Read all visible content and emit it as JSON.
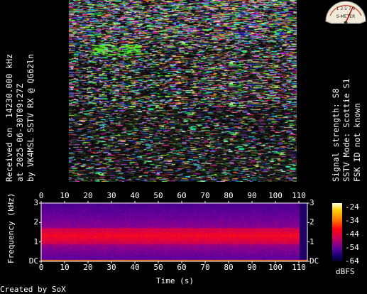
{
  "left_caption": {
    "line1": "Received on  14230.000 kHz",
    "line2": "at 2025-06-30T09:27Z",
    "line3": "by VK4MSL SSTV RX @ QG62ln"
  },
  "right_caption": {
    "line1": "Signal strength: S8",
    "line2": "SSTV Mode: Scottie S1",
    "line3": "FSK ID not known"
  },
  "meter": {
    "icon": "s-meter-icon",
    "scale_text": "1 3 5 7 9",
    "label": "S-METER"
  },
  "spectrogram": {
    "x_ticks": [
      "0",
      "10",
      "20",
      "30",
      "40",
      "50",
      "60",
      "70",
      "80",
      "90",
      "100",
      "110"
    ],
    "y_ticks": [
      "DC",
      "1",
      "2",
      "3"
    ],
    "x_label": "Time (s)",
    "y_label": "Frequency (kHz)"
  },
  "colorbar": {
    "ticks": [
      "-24",
      "-34",
      "-44",
      "-54",
      "-64"
    ],
    "unit": "dBFS"
  },
  "footer": {
    "credit": "Created by SoX"
  },
  "colors": {
    "background": "#000000",
    "text": "#ffffff"
  }
}
